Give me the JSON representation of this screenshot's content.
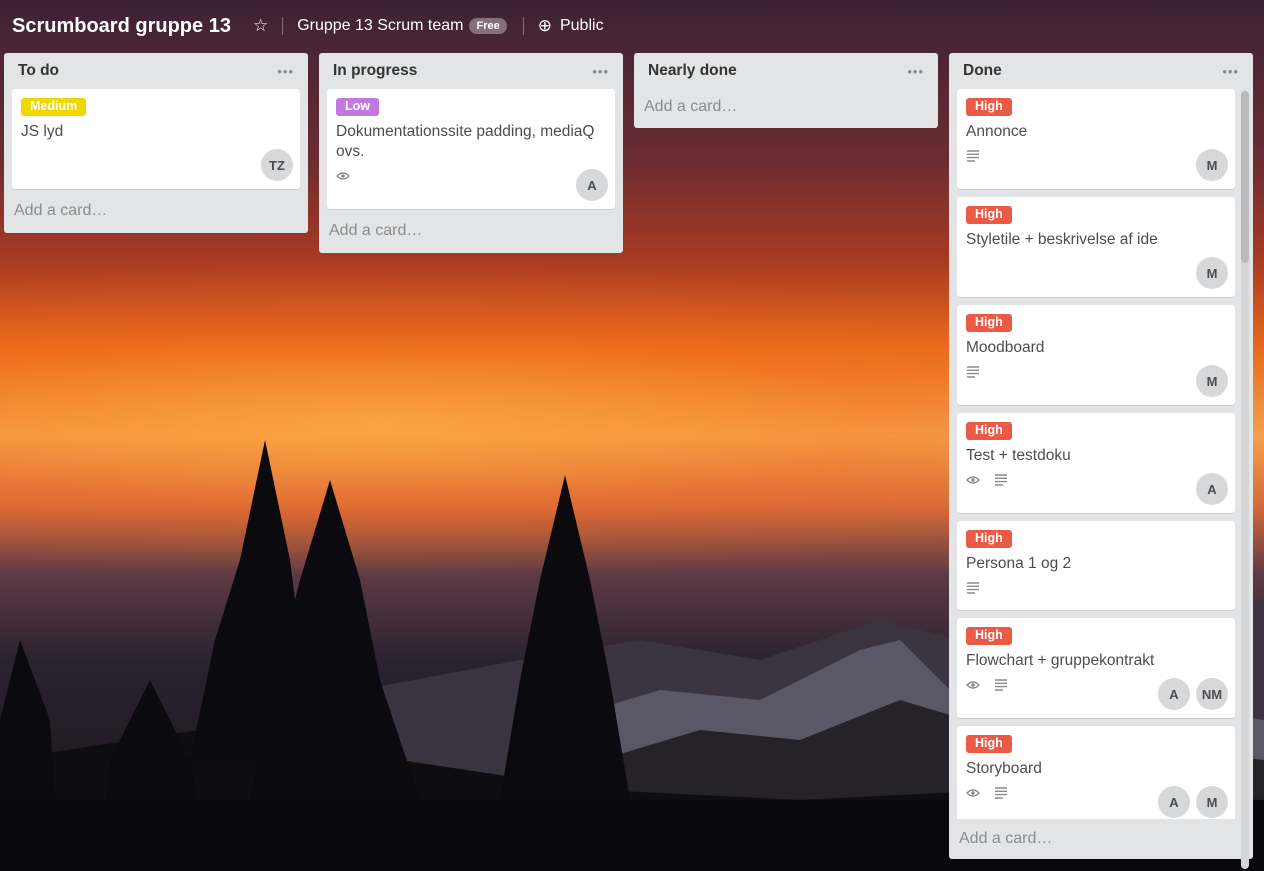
{
  "board": {
    "title": "Scrumboard gruppe 13",
    "team": "Gruppe 13 Scrum team",
    "plan_badge": "Free",
    "visibility": "Public"
  },
  "colors": {
    "high": "#eb5a46",
    "medium": "#f2d600",
    "low": "#c377e0"
  },
  "lists": [
    {
      "title": "To do",
      "add_card": "Add a card…",
      "cards": [
        {
          "label": "Medium",
          "label_color": "medium",
          "title": "JS lyd",
          "members": [
            "TZ"
          ]
        }
      ]
    },
    {
      "title": "In progress",
      "add_card": "Add a card…",
      "cards": [
        {
          "label": "Low",
          "label_color": "low",
          "title": "Dokumentationssite padding, mediaQ ovs.",
          "badges": [
            "eye-icon"
          ],
          "members": [
            "A"
          ]
        }
      ]
    },
    {
      "title": "Nearly done",
      "add_card": "Add a card…",
      "cards": []
    },
    {
      "title": "Done",
      "add_card": "Add a card…",
      "cards": [
        {
          "label": "High",
          "label_color": "high",
          "title": "Annonce",
          "badges": [
            "description-icon"
          ],
          "members": [
            "M"
          ]
        },
        {
          "label": "High",
          "label_color": "high",
          "title": "Styletile + beskrivelse af ide",
          "badges": [],
          "members": [
            "M"
          ]
        },
        {
          "label": "High",
          "label_color": "high",
          "title": "Moodboard",
          "badges": [
            "description-icon"
          ],
          "members": [
            "M"
          ]
        },
        {
          "label": "High",
          "label_color": "high",
          "title": "Test + testdoku",
          "badges": [
            "eye-icon",
            "description-icon"
          ],
          "members": [
            "A"
          ]
        },
        {
          "label": "High",
          "label_color": "high",
          "title": "Persona 1 og 2",
          "badges": [
            "description-icon"
          ],
          "members": []
        },
        {
          "label": "High",
          "label_color": "high",
          "title": "Flowchart + gruppekontrakt",
          "badges": [
            "eye-icon",
            "description-icon"
          ],
          "members": [
            "A",
            "NM"
          ]
        },
        {
          "label": "High",
          "label_color": "high",
          "title": "Storyboard",
          "badges": [
            "eye-icon",
            "description-icon"
          ],
          "members": [
            "A",
            "M"
          ]
        }
      ]
    }
  ]
}
